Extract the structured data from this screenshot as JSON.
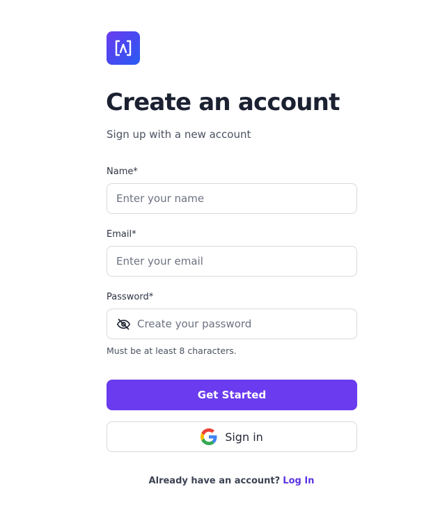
{
  "brand": {
    "logo_icon": "app-logo-icon",
    "gradient_colors": [
      "#6b3df0",
      "#2a5cf2"
    ]
  },
  "header": {
    "title": "Create an account",
    "subtitle": "Sign up with a new account"
  },
  "form": {
    "name": {
      "label": "Name*",
      "value": "",
      "placeholder": "Enter your name"
    },
    "email": {
      "label": "Email*",
      "value": "",
      "placeholder": "Enter your email"
    },
    "password": {
      "label": "Password*",
      "value": "",
      "placeholder": "Create your password",
      "toggle_icon": "eye-off-icon",
      "hint": "Must be at least 8 characters."
    },
    "submit_label": "Get Started",
    "google_label": "Sign in",
    "google_icon": "google-icon"
  },
  "footer": {
    "question": "Already have an account?",
    "login_link": "Log In"
  },
  "colors": {
    "accent": "#6a3bef",
    "link": "#5b33e0",
    "border": "#d7d9de",
    "heading": "#1b2131"
  }
}
